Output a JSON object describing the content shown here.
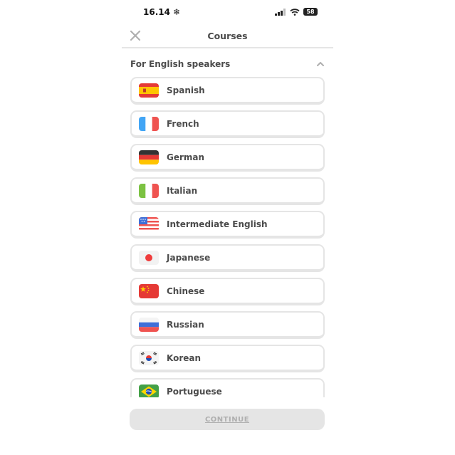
{
  "status_bar": {
    "time": "16.14 ❄",
    "battery": "58"
  },
  "header": {
    "title": "Courses"
  },
  "section": {
    "title": "For English speakers"
  },
  "courses": [
    {
      "label": "Spanish",
      "flag": "spain-flag-icon"
    },
    {
      "label": "French",
      "flag": "france-flag-icon"
    },
    {
      "label": "German",
      "flag": "germany-flag-icon"
    },
    {
      "label": "Italian",
      "flag": "italy-flag-icon"
    },
    {
      "label": "Intermediate English",
      "flag": "usa-flag-icon"
    },
    {
      "label": "Japanese",
      "flag": "japan-flag-icon"
    },
    {
      "label": "Chinese",
      "flag": "china-flag-icon"
    },
    {
      "label": "Russian",
      "flag": "russia-flag-icon"
    },
    {
      "label": "Korean",
      "flag": "korea-flag-icon"
    },
    {
      "label": "Portuguese",
      "flag": "brazil-flag-icon"
    }
  ],
  "footer": {
    "continue_label": "CONTINUE"
  },
  "colors": {
    "border": "#e5e5e5",
    "text": "#4b4b4b",
    "disabled_button": "#e5e5e5",
    "disabled_text": "#afafaf"
  }
}
